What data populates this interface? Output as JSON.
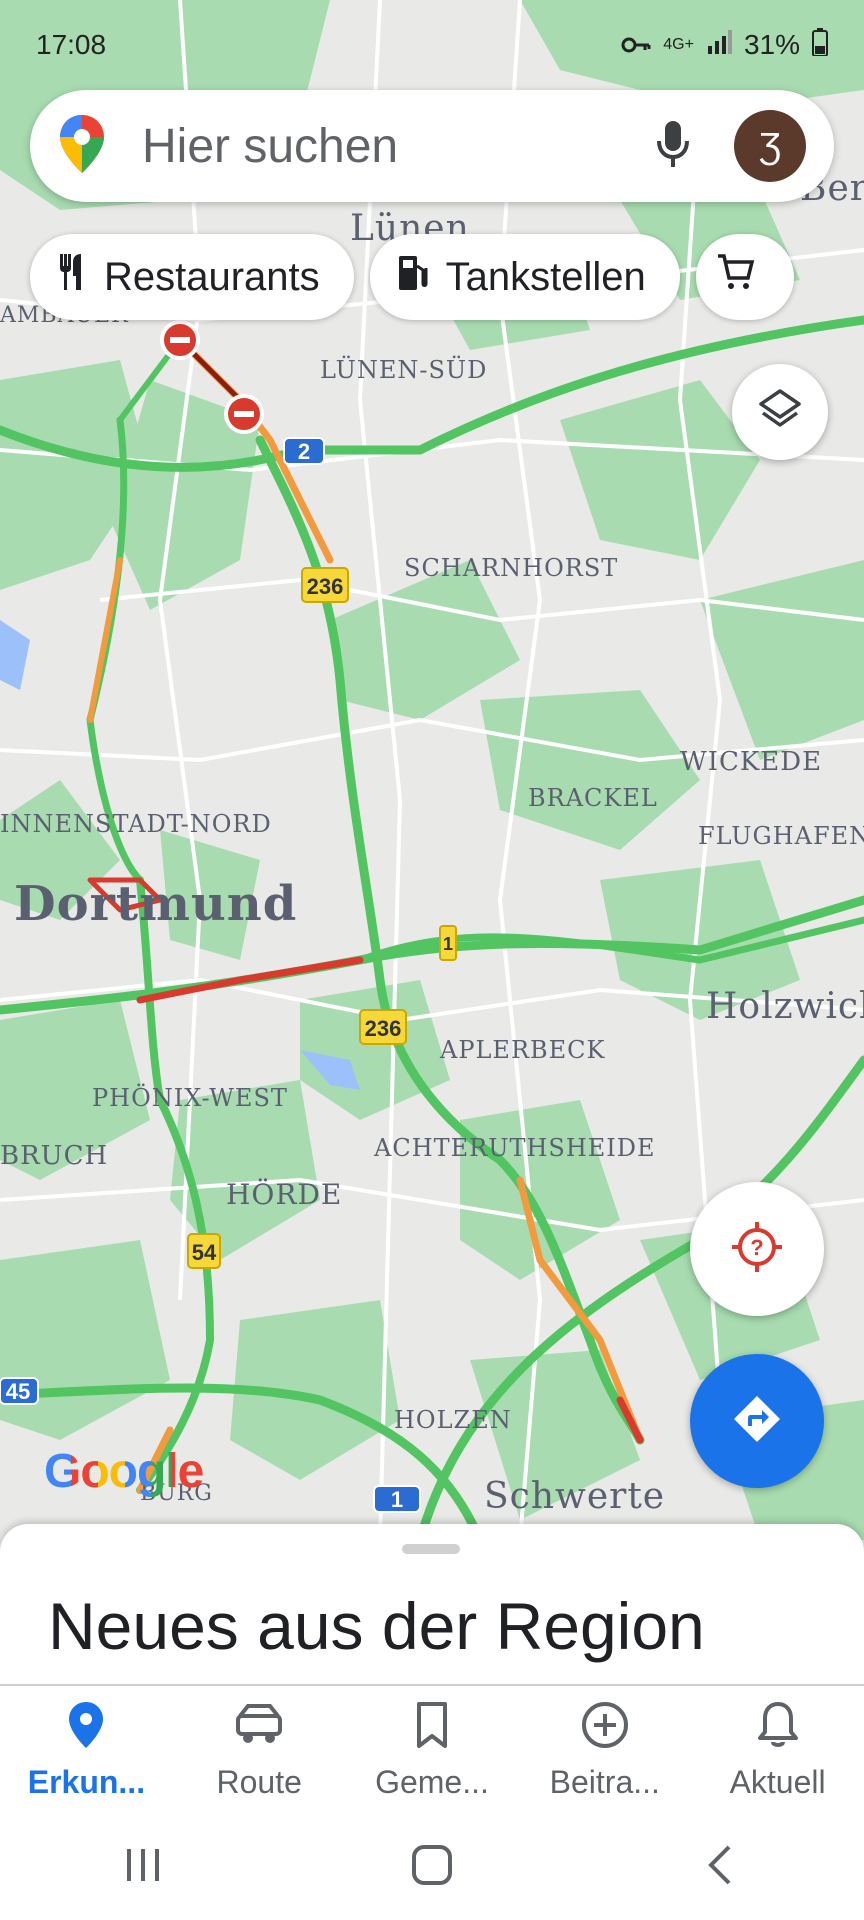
{
  "status_bar": {
    "time": "17:08",
    "network": "4G+",
    "battery": "31%"
  },
  "search": {
    "placeholder": "Hier suchen",
    "avatar_initial": "Ʒ"
  },
  "chips": [
    {
      "label": "Restaurants",
      "icon": "fork-knife-icon"
    },
    {
      "label": "Tankstellen",
      "icon": "gas-station-icon"
    },
    {
      "label": "",
      "icon": "shopping-cart-icon"
    }
  ],
  "map": {
    "labels": {
      "luenen": "Lünen",
      "luenen_sued": "LÜNEN-SÜD",
      "scharnhorst": "SCHARNHORST",
      "wickede": "WICKEDE",
      "brackel": "BRACKEL",
      "flughafen": "FLUGHAFEN",
      "innenstadt_nord": "INNENSTADT-NORD",
      "dortmund": "Dortmund",
      "holzwickede": "Holzwicke",
      "aplerbeck": "APLERBECK",
      "phoenix_west": "PHÖNIX-WEST",
      "bruch": "BRUCH",
      "achterruthsheide": "ACHTERUTHSHEIDE",
      "hoerde": "HÖRDE",
      "holzen": "HOLZEN",
      "schwerte": "Schwerte",
      "berg": "Ber",
      "ambauer": "AMBAUER",
      "burg": "BURG"
    },
    "road_shields": [
      "2",
      "236",
      "1",
      "236",
      "54",
      "45",
      "1"
    ]
  },
  "logo": {
    "text": "Google"
  },
  "sheet": {
    "title": "Neues aus der Region"
  },
  "nav": [
    {
      "label": "Erkun...",
      "icon": "explore-pin-icon",
      "active": true
    },
    {
      "label": "Route",
      "icon": "car-icon",
      "active": false
    },
    {
      "label": "Geme...",
      "icon": "bookmark-icon",
      "active": false
    },
    {
      "label": "Beitra...",
      "icon": "add-circle-icon",
      "active": false
    },
    {
      "label": "Aktuell",
      "icon": "bell-icon",
      "active": false
    }
  ],
  "colors": {
    "accent": "#1a73e8",
    "traffic_green": "#52c461",
    "traffic_orange": "#f19a3e",
    "traffic_red": "#d83a2e"
  }
}
